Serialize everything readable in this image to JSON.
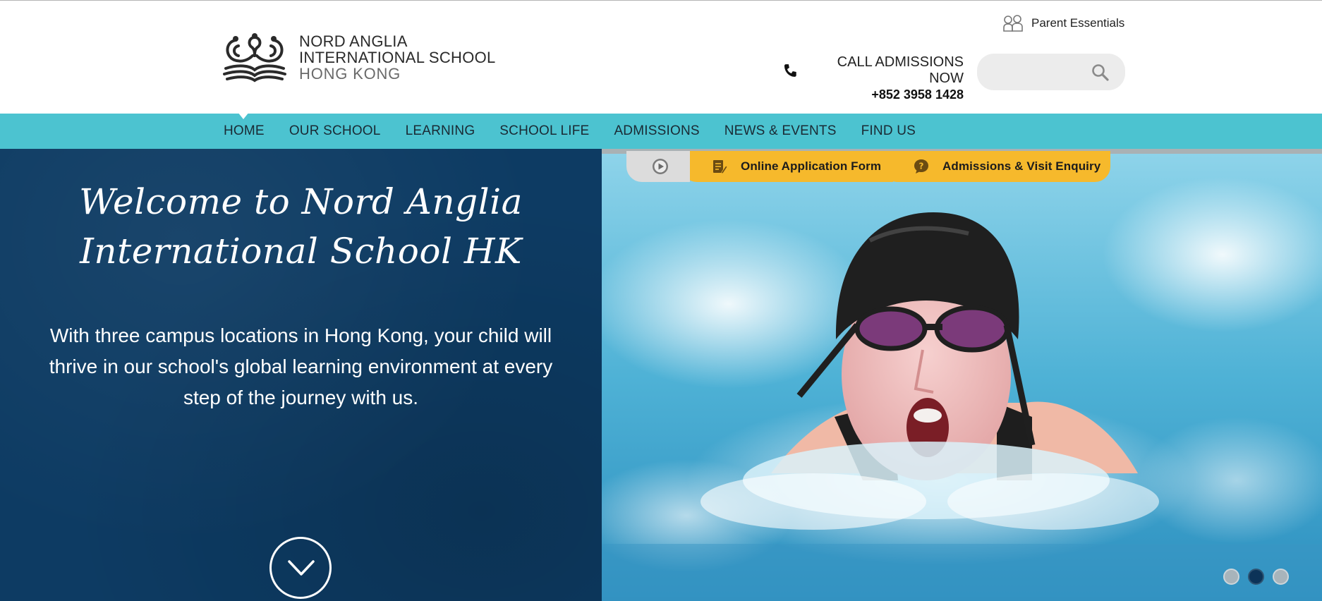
{
  "header": {
    "logo": {
      "line1": "NORD ANGLIA",
      "line2": "INTERNATIONAL SCHOOL",
      "line3": "HONG KONG"
    },
    "parent_essentials": "Parent Essentials",
    "call": {
      "label": "CALL ADMISSIONS NOW",
      "number": "+852 3958 1428"
    },
    "search": {
      "placeholder": "",
      "value": "",
      "icon": "search-icon"
    }
  },
  "nav": {
    "items": [
      {
        "label": "HOME",
        "active": true
      },
      {
        "label": "OUR SCHOOL"
      },
      {
        "label": "LEARNING"
      },
      {
        "label": "SCHOOL LIFE"
      },
      {
        "label": "ADMISSIONS"
      },
      {
        "label": "NEWS & EVENTS"
      },
      {
        "label": "FIND US"
      }
    ]
  },
  "hero": {
    "title_line1": "Welcome to Nord Anglia",
    "title_line2": "International School HK",
    "intro": "With three campus locations in Hong Kong, your child will thrive in our school's global learning environment at every step of the journey with us.",
    "scroll_icon": "chevron-down-icon",
    "slides": {
      "count": 3,
      "active": 2
    }
  },
  "tabs": {
    "play_icon": "play-icon",
    "online_application": "Online Application Form",
    "enquiry": "Admissions & Visit Enquiry"
  },
  "colors": {
    "nav": "#4cc3d0",
    "hero_left": "#0d3b63",
    "tab_yellow": "#f6b92c",
    "dot_active": "#0c3358"
  }
}
